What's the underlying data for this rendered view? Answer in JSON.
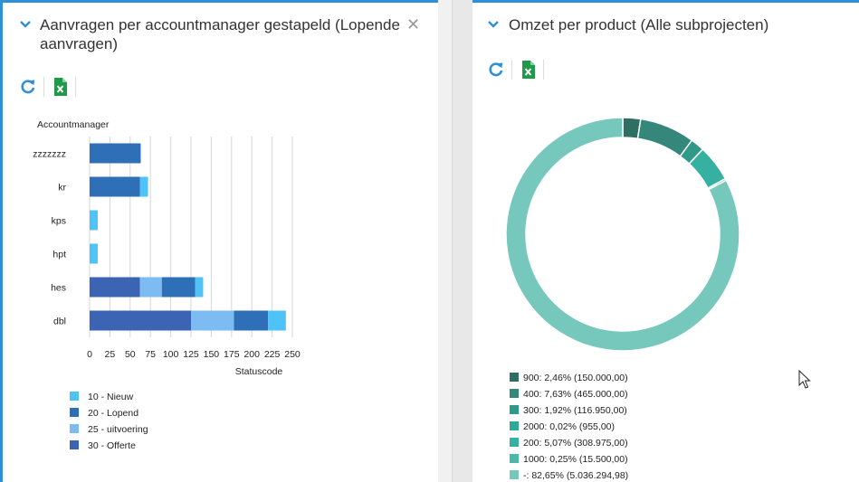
{
  "left_panel": {
    "title": "Aanvragen per accountmanager gestapeld (Lopende aanvragen)",
    "title_line1": "Aanvragen per accountmanager gestapeld (Lopende",
    "title_line2": "aanvragen)",
    "close_icon": "close-icon",
    "toolbar": {
      "refresh_icon": "refresh-icon",
      "excel_icon": "excel-export-icon"
    }
  },
  "right_panel": {
    "title": "Omzet per product (Alle subprojecten)",
    "toolbar": {
      "refresh_icon": "refresh-icon",
      "excel_icon": "excel-export-icon"
    }
  },
  "colors": {
    "accent": "#2f8fd8",
    "status_10": "#4fc3f7",
    "status_20": "#2f6fb8",
    "status_25": "#7dbcf2",
    "status_30": "#3b64b5"
  },
  "chart_data": [
    {
      "type": "bar",
      "orientation": "horizontal",
      "stacked": true,
      "ylabel": "Accountmanager",
      "xlabel": "Statuscode",
      "categories": [
        "zzzzzzz",
        "kr",
        "kps",
        "hpt",
        "hes",
        "dbl"
      ],
      "xlim": [
        0,
        250
      ],
      "xticks": [
        "0",
        "25",
        "50",
        "75",
        "100",
        "125",
        "150",
        "175",
        "200",
        "225",
        "250"
      ],
      "grid": true,
      "legend_position": "bottom",
      "series": [
        {
          "name": "30 - Offerte",
          "color": "#3b64b5",
          "values": [
            0,
            0,
            0,
            0,
            62,
            125
          ]
        },
        {
          "name": "25 - uitvoering",
          "color": "#7dbcf2",
          "values": [
            0,
            0,
            0,
            0,
            27,
            53
          ]
        },
        {
          "name": "20 - Lopend",
          "color": "#2f6fb8",
          "values": [
            63,
            62,
            0,
            0,
            41,
            42
          ]
        },
        {
          "name": "10 - Nieuw",
          "color": "#4fc3f7",
          "values": [
            0,
            10,
            10,
            10,
            10,
            22
          ]
        }
      ],
      "legend": [
        {
          "label": "10 - Nieuw",
          "color": "#4fc3f7"
        },
        {
          "label": "20 - Lopend",
          "color": "#2f6fb8"
        },
        {
          "label": "25 - uitvoering",
          "color": "#7dbcf2"
        },
        {
          "label": "30 - Offerte",
          "color": "#3b64b5"
        }
      ]
    },
    {
      "type": "pie",
      "donut": true,
      "legend_position": "bottom",
      "slices": [
        {
          "label": "900: 2,46% (150.000,00)",
          "value": 150000.0,
          "color": "#2e6e63"
        },
        {
          "label": "400: 7,63% (465.000,00)",
          "value": 465000.0,
          "color": "#34877a"
        },
        {
          "label": "300: 1,92% (116.950,00)",
          "value": 116950.0,
          "color": "#2f9a88"
        },
        {
          "label": "2000: 0,02% (955,00)",
          "value": 955.0,
          "color": "#2ea897"
        },
        {
          "label": "200: 5,07% (308.975,00)",
          "value": 308975.0,
          "color": "#36b0a0"
        },
        {
          "label": "1000: 0,25% (15.500,00)",
          "value": 15500.0,
          "color": "#4bb8a9"
        },
        {
          "label": "-: 82,65% (5.036.294,98)",
          "value": 5036294.98,
          "color": "#76c8bd"
        }
      ]
    }
  ]
}
